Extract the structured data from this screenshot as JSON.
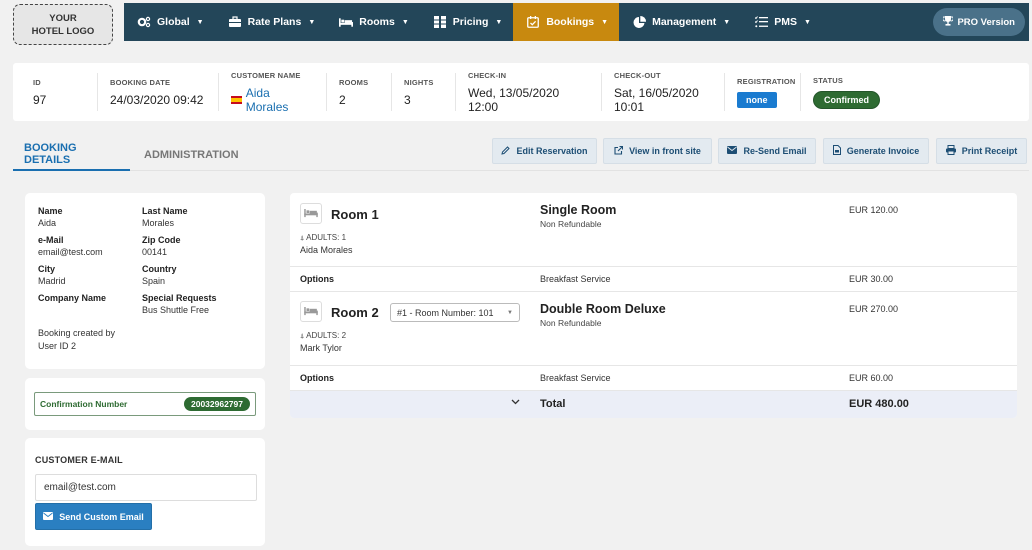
{
  "header": {
    "logo_line1": "YOUR",
    "logo_line2": "HOTEL LOGO",
    "nav": [
      {
        "label": "Global",
        "icon": "gears-icon"
      },
      {
        "label": "Rate Plans",
        "icon": "briefcase-icon"
      },
      {
        "label": "Rooms",
        "icon": "bed-icon"
      },
      {
        "label": "Pricing",
        "icon": "table-icon"
      },
      {
        "label": "Bookings",
        "icon": "calendar-check-icon",
        "active": true
      },
      {
        "label": "Management",
        "icon": "pie-chart-icon"
      },
      {
        "label": "PMS",
        "icon": "list-check-icon"
      }
    ],
    "pro_label": "PRO Version"
  },
  "summary": {
    "id_label": "ID",
    "id": "97",
    "booking_date_label": "BOOKING DATE",
    "booking_date": "24/03/2020 09:42",
    "customer_label": "CUSTOMER NAME",
    "customer": "Aida Morales",
    "rooms_label": "ROOMS",
    "rooms": "2",
    "nights_label": "NIGHTS",
    "nights": "3",
    "checkin_label": "CHECK-IN",
    "checkin": "Wed, 13/05/2020 12:00",
    "checkout_label": "CHECK-OUT",
    "checkout": "Sat, 16/05/2020 10:01",
    "registration_label": "REGISTRATION",
    "registration": "none",
    "status_label": "STATUS",
    "status": "Confirmed"
  },
  "tabs": {
    "booking_details": "BOOKING DETAILS",
    "administration": "ADMINISTRATION"
  },
  "actions": {
    "edit": "Edit Reservation",
    "view": "View in front site",
    "resend": "Re-Send Email",
    "invoice": "Generate Invoice",
    "print": "Print Receipt"
  },
  "customer_info": {
    "name_label": "Name",
    "name": "Aida",
    "last_name_label": "Last Name",
    "last_name": "Morales",
    "email_label": "e-Mail",
    "email": "email@test.com",
    "zip_label": "Zip Code",
    "zip": "00141",
    "city_label": "City",
    "city": "Madrid",
    "country_label": "Country",
    "country": "Spain",
    "company_label": "Company Name",
    "company": "",
    "requests_label": "Special Requests",
    "requests": "Bus Shuttle Free",
    "created_line1": "Booking created by",
    "created_line2": "User ID 2"
  },
  "confirmation": {
    "label": "Confirmation Number",
    "number": "20032962797"
  },
  "customer_email": {
    "title": "CUSTOMER E-MAIL",
    "value": "email@test.com",
    "send_label": "Send Custom Email"
  },
  "rooms": [
    {
      "name": "Room 1",
      "adults": "ADULTS: 1",
      "guest": "Aida Morales",
      "type": "Single Room",
      "policy": "Non Refundable",
      "price": "EUR 120.00",
      "options_label": "Options",
      "option": "Breakfast Service",
      "option_price": "EUR 30.00"
    },
    {
      "name": "Room 2",
      "room_number_select": "#1 - Room Number: 101",
      "adults": "ADULTS: 2",
      "guest": "Mark Tylor",
      "type": "Double Room Deluxe",
      "policy": "Non Refundable",
      "price": "EUR 270.00",
      "options_label": "Options",
      "option": "Breakfast Service",
      "option_price": "EUR 60.00"
    }
  ],
  "total": {
    "label": "Total",
    "value": "EUR 480.00"
  },
  "colors": {
    "nav_bg": "#234659",
    "nav_active": "#c8890f",
    "link_blue": "#1a6fb0",
    "confirmed_green": "#2e6b32",
    "registration_blue": "#1a7bd0"
  }
}
